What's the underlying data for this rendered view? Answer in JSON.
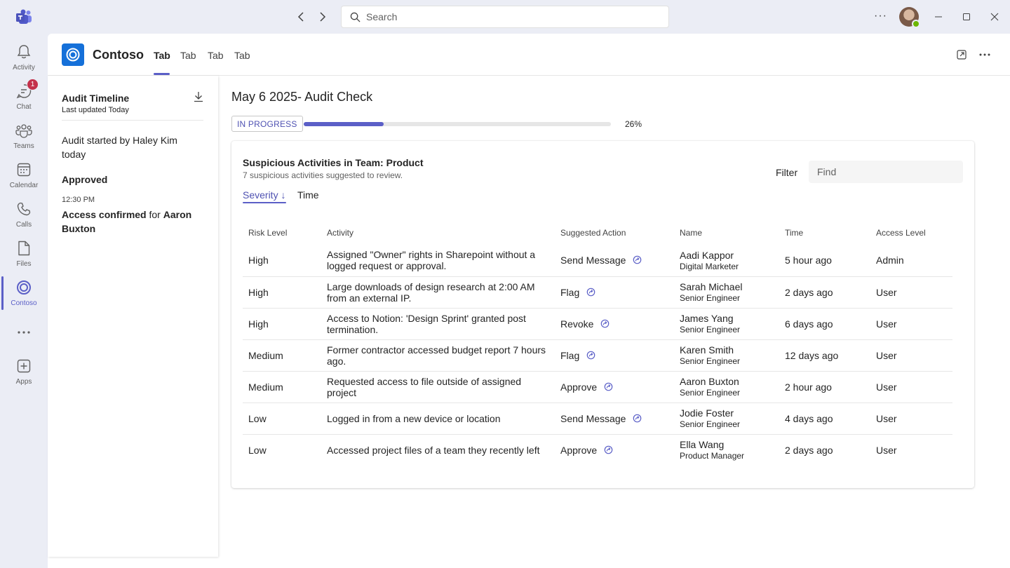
{
  "titlebar": {
    "search_placeholder": "Search",
    "more_label": "···"
  },
  "rail": {
    "items": [
      {
        "label": "Activity",
        "icon": "bell-icon"
      },
      {
        "label": "Chat",
        "icon": "chat-icon",
        "badge": "1"
      },
      {
        "label": "Teams",
        "icon": "teams-icon"
      },
      {
        "label": "Calendar",
        "icon": "calendar-icon"
      },
      {
        "label": "Calls",
        "icon": "phone-icon"
      },
      {
        "label": "Files",
        "icon": "file-icon"
      },
      {
        "label": "Contoso",
        "icon": "contoso-icon",
        "active": true
      },
      {
        "label": "",
        "icon": "more-icon"
      },
      {
        "label": "Apps",
        "icon": "add-app-icon"
      }
    ]
  },
  "app": {
    "name": "Contoso",
    "tabs": [
      "Tab",
      "Tab",
      "Tab",
      "Tab"
    ],
    "active_tab": 0
  },
  "timeline": {
    "title": "Audit Timeline",
    "subtitle": "Last updated Today",
    "started": "Audit started by Haley Kim today",
    "approved_heading": "Approved",
    "event_time": "12:30 PM",
    "event_prefix": "Access confirmed",
    "event_mid": " for ",
    "event_person": "Aaron Buxton"
  },
  "audit": {
    "title": "May 6 2025- Audit Check",
    "status": "IN PROGRESS",
    "progress_fraction": 0.26,
    "progress_label": "26%"
  },
  "card": {
    "title": "Suspicious Activities in Team: Product",
    "subtitle": "7 suspicious activities suggested to review.",
    "filter_label": "Filter",
    "find_placeholder": "Find",
    "sort_tabs": [
      "Severity ↓",
      "Time"
    ],
    "columns": [
      "Risk Level",
      "Activity",
      "Suggested Action",
      "Name",
      "Time",
      "Access Level"
    ],
    "rows": [
      {
        "risk": "High",
        "activity": "Assigned \"Owner\" rights in Sharepoint without a logged request or approval.",
        "action": "Send Message",
        "name": "Aadi Kappor",
        "role": "Digital Marketer",
        "time": "5 hour ago",
        "access": "Admin"
      },
      {
        "risk": "High",
        "activity": "Large downloads of design research at 2:00 AM from an external IP.",
        "action": "Flag",
        "name": "Sarah Michael",
        "role": "Senior Engineer",
        "time": "2 days ago",
        "access": "User"
      },
      {
        "risk": "High",
        "activity": "Access to Notion: 'Design Sprint' granted post termination.",
        "action": "Revoke",
        "name": "James Yang",
        "role": "Senior Engineer",
        "time": "6 days ago",
        "access": "User"
      },
      {
        "risk": "Medium",
        "activity": "Former contractor accessed budget report 7 hours ago.",
        "action": "Flag",
        "name": "Karen Smith",
        "role": "Senior Engineer",
        "time": "12 days ago",
        "access": "User"
      },
      {
        "risk": "Medium",
        "activity": "Requested access to file outside of assigned project",
        "action": "Approve",
        "name": "Aaron Buxton",
        "role": "Senior Engineer",
        "time": "2 hour ago",
        "access": "User"
      },
      {
        "risk": "Low",
        "activity": "Logged in from a new device or location",
        "action": "Send Message",
        "name": "Jodie Foster",
        "role": "Senior Engineer",
        "time": "4 days ago",
        "access": "User"
      },
      {
        "risk": "Low",
        "activity": "Accessed project files of a team they recently left",
        "action": "Approve",
        "name": "Ella Wang",
        "role": "Product Manager",
        "time": "2 days ago",
        "access": "User"
      }
    ]
  },
  "colors": {
    "accent": "#5b5fc7",
    "app_logo": "#1570d9",
    "badge": "#c4314b",
    "presence": "#6bb700"
  }
}
